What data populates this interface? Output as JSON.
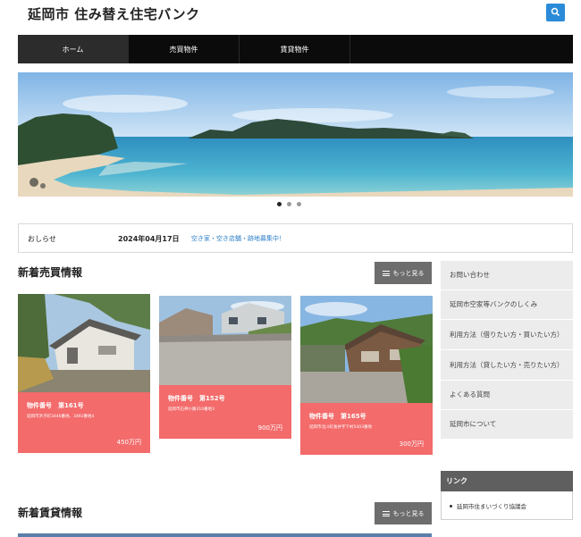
{
  "header": {
    "site_title": "延岡市 住み替え住宅バンク"
  },
  "nav": {
    "items": [
      {
        "label": "ホーム",
        "active": true
      },
      {
        "label": "売買物件",
        "active": false
      },
      {
        "label": "賃貸物件",
        "active": false
      }
    ]
  },
  "slider": {
    "dots": 3,
    "active_dot": 1
  },
  "notice": {
    "label": "おしらせ",
    "date": "2024年04月17日",
    "message": "空き家・空き店舗・跡地募集中！"
  },
  "sale_section": {
    "title": "新着売買情報",
    "more_label": "もっと見る",
    "properties": [
      {
        "number_label": "物件番号　第161号",
        "address": "延岡市浜子町3446番地、3492番地4",
        "price": "450万円"
      },
      {
        "number_label": "物件番号　第152号",
        "address": "延岡市石神小路310番地3",
        "price": "900万円"
      },
      {
        "number_label": "物件番号　第165号",
        "address": "延岡市北川町長井字下村5403番地",
        "price": "300万円"
      }
    ]
  },
  "rent_section": {
    "title": "新着賃貸情報",
    "more_label": "もっと見る"
  },
  "sidebar": {
    "menu": [
      "お問い合わせ",
      "延岡市空家等バンクのしくみ",
      "利用方法（借りたい方・買いたい方）",
      "利用方法（貸したい方・売りたい方）",
      "よくある質問",
      "延岡市について"
    ],
    "links_title": "リンク",
    "links": [
      "延岡市住まいづくり協議会"
    ]
  },
  "colors": {
    "accent_blue": "#2b8bd8",
    "nav_bg": "#0b0b0b",
    "card_red": "#f36b6b",
    "link_blue": "#2b7fc7"
  }
}
